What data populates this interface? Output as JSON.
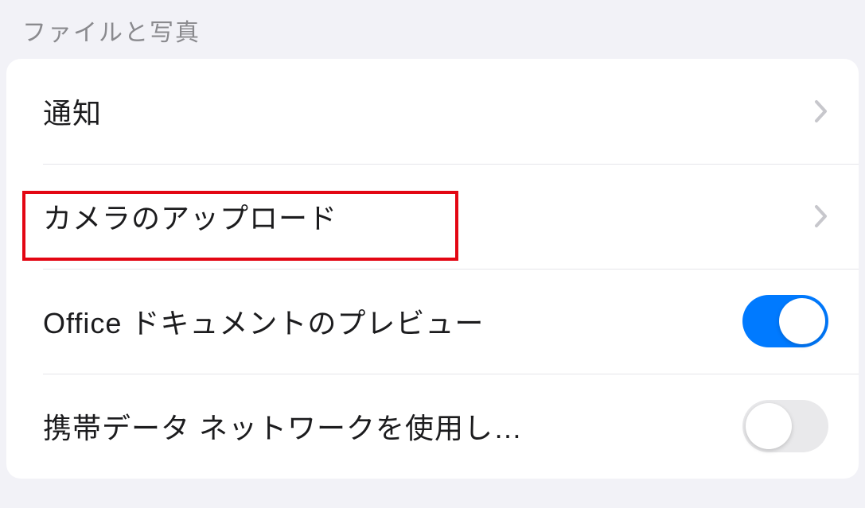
{
  "section": {
    "header": "ファイルと写真"
  },
  "rows": {
    "notifications": {
      "label": "通知"
    },
    "cameraUpload": {
      "label": "カメラのアップロード"
    },
    "officePreview": {
      "label": "Office ドキュメントのプレビュー",
      "toggle": true
    },
    "cellularData": {
      "label": "携帯データ ネットワークを使用し…",
      "toggle": false
    }
  },
  "colors": {
    "accent": "#007aff",
    "highlight": "#e30613"
  }
}
